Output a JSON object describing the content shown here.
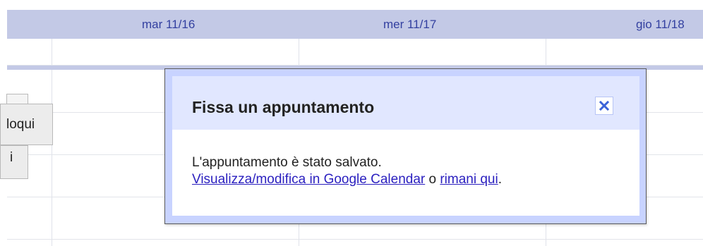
{
  "calendar": {
    "day_headers": [
      "mar 11/16",
      "mer 11/17",
      "gio 11/18"
    ],
    "side_buttons": [
      "loqui",
      "i"
    ]
  },
  "dialog": {
    "title": "Fissa un appuntamento",
    "message": "L'appuntamento è stato salvato.",
    "link_edit": "Visualizza/modifica in Google Calendar",
    "conjunction": "o",
    "link_stay": "rimani qui",
    "period": ".",
    "close_icon": "close-icon"
  },
  "colors": {
    "header_bg": "#c3c9e6",
    "day_label": "#3340a0",
    "dialog_frame": "#c8d3ff",
    "dialog_header": "#e1e7ff",
    "link": "#2a1fbf"
  }
}
